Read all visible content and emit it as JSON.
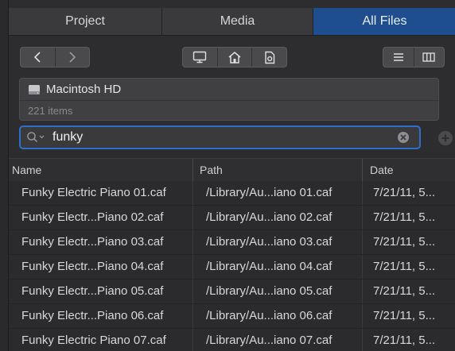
{
  "tabs": [
    {
      "label": "Project",
      "active": false
    },
    {
      "label": "Media",
      "active": false
    },
    {
      "label": "All Files",
      "active": true
    }
  ],
  "toolbar": {
    "back_icon": "chevron-left-icon",
    "forward_icon": "chevron-right-icon",
    "computer_icon": "computer-icon",
    "home_icon": "home-icon",
    "project_icon": "project-file-icon",
    "list_view_icon": "list-view-icon",
    "column_view_icon": "column-view-icon"
  },
  "location": {
    "name": "Macintosh HD",
    "count": "221 items"
  },
  "search": {
    "value": "funky",
    "placeholder": ""
  },
  "table": {
    "columns": [
      "Name",
      "Path",
      "Date"
    ],
    "rows": [
      {
        "name": "Funky Electric Piano 01.caf",
        "path": "/Library/Au...iano 01.caf",
        "date": "7/21/11, 5..."
      },
      {
        "name": "Funky Electr...Piano 02.caf",
        "path": "/Library/Au...iano 02.caf",
        "date": "7/21/11, 5..."
      },
      {
        "name": "Funky Electr...Piano 03.caf",
        "path": "/Library/Au...iano 03.caf",
        "date": "7/21/11, 5..."
      },
      {
        "name": "Funky Electr...Piano 04.caf",
        "path": "/Library/Au...iano 04.caf",
        "date": "7/21/11, 5..."
      },
      {
        "name": "Funky Electr...Piano 05.caf",
        "path": "/Library/Au...iano 05.caf",
        "date": "7/21/11, 5..."
      },
      {
        "name": "Funky Electr...Piano 06.caf",
        "path": "/Library/Au...iano 06.caf",
        "date": "7/21/11, 5..."
      },
      {
        "name": "Funky Electric Piano 07.caf",
        "path": "/Library/Au...iano 07.caf",
        "date": "7/21/11, 5..."
      }
    ]
  },
  "colors": {
    "accent": "#2f6fcb",
    "active_tab": "#1f4e8f"
  }
}
